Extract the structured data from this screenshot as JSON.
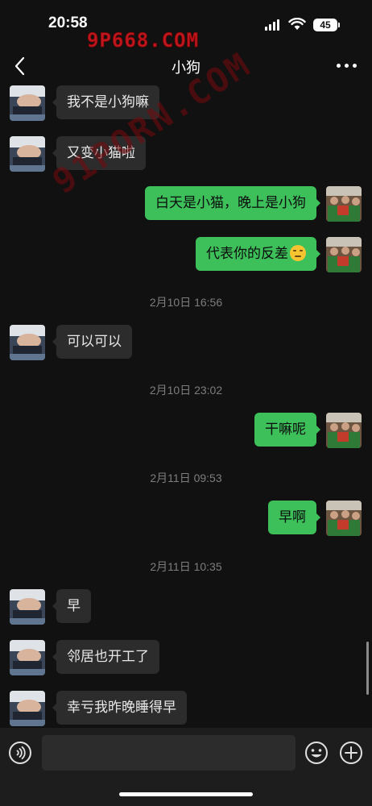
{
  "status_bar": {
    "time": "20:58",
    "battery": "45"
  },
  "watermarks": {
    "top": "9P668.COM",
    "diagonal": "91PORN.COM"
  },
  "nav": {
    "title": "小狗",
    "back_icon": "chevron-left-icon",
    "more_icon": "ellipsis-icon"
  },
  "messages": [
    {
      "side": "left",
      "text": "我不是小狗嘛"
    },
    {
      "side": "left",
      "text": "又变小猫啦"
    },
    {
      "side": "right",
      "text": "白天是小猫，晚上是小狗"
    },
    {
      "side": "right",
      "text": "代表你的反差",
      "emoji": "thinking-face-emoji"
    },
    {
      "type": "time",
      "text": "2月10日 16:56"
    },
    {
      "side": "left",
      "text": "可以可以"
    },
    {
      "type": "time",
      "text": "2月10日 23:02"
    },
    {
      "side": "right",
      "text": "干嘛呢"
    },
    {
      "type": "time",
      "text": "2月11日 09:53"
    },
    {
      "side": "right",
      "text": "早啊"
    },
    {
      "type": "time",
      "text": "2月11日 10:35"
    },
    {
      "side": "left",
      "text": "早"
    },
    {
      "side": "left",
      "text": "邻居也开工了"
    },
    {
      "side": "left",
      "text": "幸亏我昨晚睡得早"
    }
  ],
  "input_bar": {
    "placeholder": "",
    "voice_icon": "voice-icon",
    "emoji_icon": "smiley-icon",
    "plus_icon": "plus-icon"
  },
  "colors": {
    "background": "#111111",
    "sent_bubble": "#3dbf5a",
    "received_bubble": "#2c2c2c",
    "timestamp": "#7d7d7d"
  }
}
